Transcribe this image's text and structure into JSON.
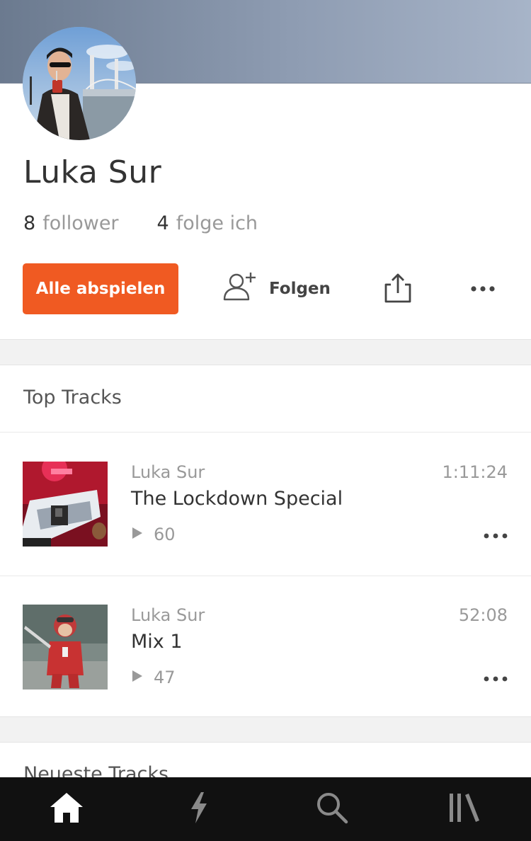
{
  "profile": {
    "name": "Luka Sur",
    "stats": [
      {
        "count": "8",
        "label": "follower"
      },
      {
        "count": "4",
        "label": "folge ich"
      }
    ]
  },
  "actions": {
    "play_all_label": "Alle abspielen",
    "follow_label": "Folgen"
  },
  "sections": {
    "top_tracks_title": "Top Tracks",
    "newest_tracks_title": "Neueste Tracks"
  },
  "tracks": [
    {
      "artist": "Luka Sur",
      "title": "The Lockdown Special",
      "plays": "60",
      "duration": "1:11:24"
    },
    {
      "artist": "Luka Sur",
      "title": "Mix 1",
      "plays": "47",
      "duration": "52:08"
    }
  ],
  "nav": {
    "tabs": [
      {
        "icon": "home-icon",
        "active": true
      },
      {
        "icon": "stream-bolt-icon",
        "active": false
      },
      {
        "icon": "search-icon",
        "active": false
      },
      {
        "icon": "library-icon",
        "active": false
      }
    ]
  },
  "colors": {
    "accent": "#f05a22",
    "nav_background": "#111111"
  }
}
